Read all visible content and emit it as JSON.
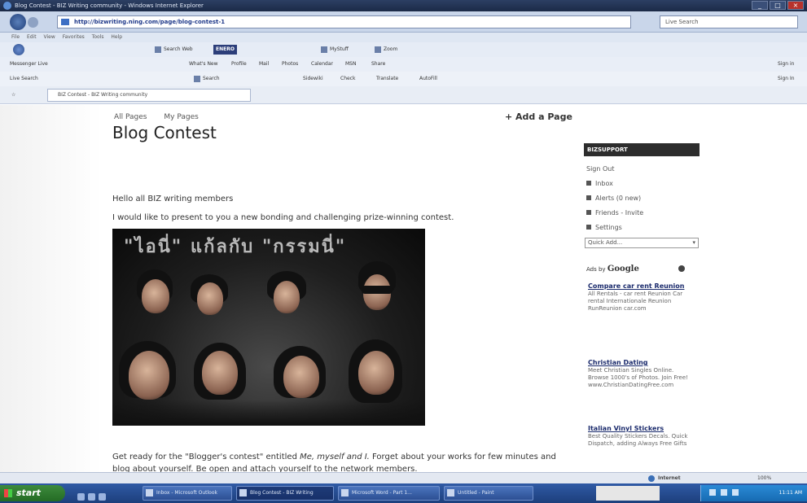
{
  "window": {
    "title": "Blog Contest - BIZ Writing community - Windows Internet Explorer",
    "address": "http://bizwriting.ning.com/page/blog-contest-1",
    "search_engine": "Live Search"
  },
  "menubar": [
    "File",
    "Edit",
    "View",
    "Favorites",
    "Tools",
    "Help"
  ],
  "toolbars": {
    "row1": {
      "search_web": "Search Web",
      "brand": "ENERO",
      "mystuff": "MyStuff",
      "zoom": "Zoom"
    },
    "row2": {
      "left": "Messenger Live",
      "items": [
        "What's New",
        "Profile",
        "Mail",
        "Photos",
        "Calendar",
        "MSN",
        "Share"
      ],
      "right": "Sign in"
    },
    "row3": {
      "left": "Live Search",
      "search": "Search",
      "items": [
        "Sidewiki",
        "Check",
        "Translate",
        "AutoFill"
      ],
      "right": "Sign In"
    }
  },
  "tab": {
    "label": "BIZ Contest - BIZ Writing community"
  },
  "page": {
    "top_links": [
      "All Pages",
      "My Pages"
    ],
    "add_page": "+ Add a Page",
    "title": "Blog Contest",
    "greeting": "Hello all BIZ writing members",
    "intro": "I would like to present to you a new bonding and challenging prize-winning contest.",
    "image_banner": "\"ไอนี่\" แก้ลกับ \"กรรมนี่\"",
    "para_start": "Get ready for the \"Blogger's contest\" entitled ",
    "para_title": "Me, myself and I.",
    "para_end": " Forget about your works for few minutes and blog about yourself. Be open and attach yourself to the network members."
  },
  "sidebar": {
    "header": "BIZSUPPORT",
    "sign_out": "Sign Out",
    "items": [
      {
        "label": "Inbox",
        "icon": "envelope-icon"
      },
      {
        "label": "Alerts (0 new)",
        "icon": "alert-icon"
      },
      {
        "label": "Friends - Invite",
        "icon": "friends-icon"
      },
      {
        "label": "Settings",
        "icon": "gear-icon"
      }
    ],
    "quick_add": "Quick Add...",
    "ads_by": "Ads by",
    "ads_brand": "Google",
    "ads": [
      {
        "title": "Compare car rent Reunion",
        "text": "All Rentals - car rent Reunion Car rental Internationale Reunion RunReunion car.com"
      },
      {
        "title": "Christian Dating",
        "text": "Meet Christian Singles Online. Browse 1000's of Photos. Join Free! www.ChristianDatingFree.com"
      },
      {
        "title": "Italian Vinyl Stickers",
        "text": "Best Quality Stickers Decals. Quick Dispatch, adding Always Free Gifts"
      }
    ]
  },
  "status": {
    "zone": "Internet",
    "zoom": "100%"
  },
  "taskbar": {
    "start": "start",
    "tasks": [
      "Inbox - Microsoft Outlook",
      "Blog Contest - BIZ Writing",
      "Microsoft Word - Part 1...",
      "Untitled - Paint"
    ],
    "clock": "11:11 AM"
  }
}
